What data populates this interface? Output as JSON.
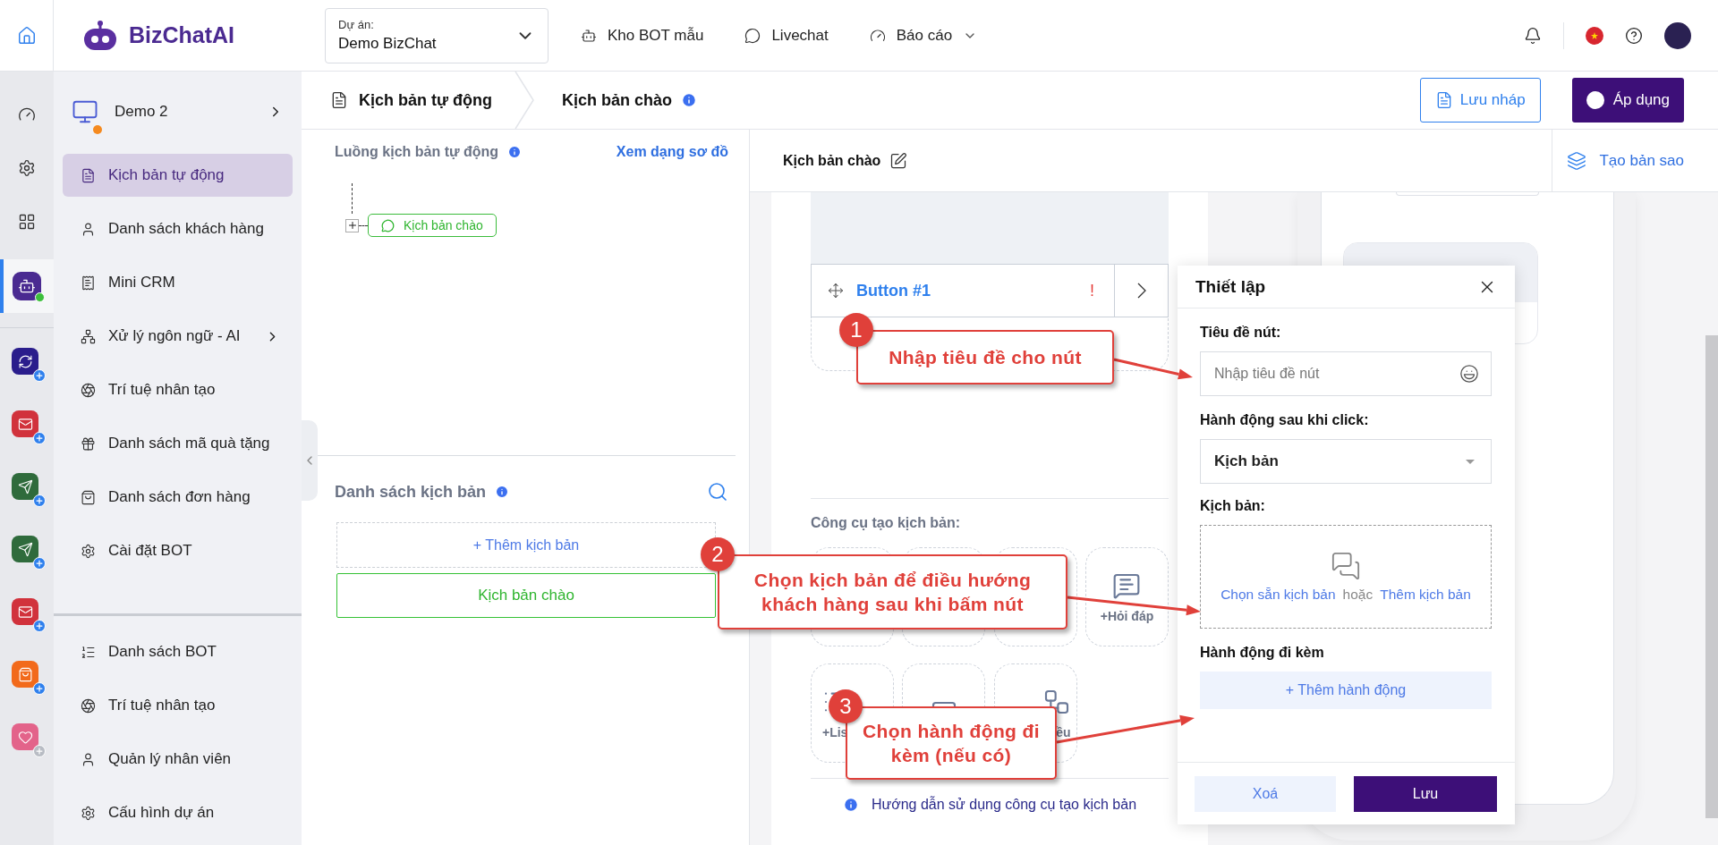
{
  "topbar": {
    "logo": "BizChatAI",
    "project": {
      "label": "Dự án:",
      "value": "Demo BizChat"
    },
    "nav": [
      {
        "kind": "bot",
        "label": "Kho BOT mẫu",
        "dropdown": false
      },
      {
        "kind": "chat",
        "label": "Livechat",
        "dropdown": false
      },
      {
        "kind": "gauge",
        "label": "Báo cáo",
        "dropdown": true
      }
    ]
  },
  "rail": {
    "items": [
      {
        "kind": "gauge",
        "selected": false
      },
      {
        "kind": "settings",
        "selected": false
      },
      {
        "kind": "grid",
        "selected": false
      },
      {
        "kind": "bot",
        "selected": true
      }
    ],
    "apps": [
      {
        "kind": "refresh",
        "color": "#2a1d8c",
        "added": true
      },
      {
        "kind": "mail",
        "color": "#d1323c",
        "added": true
      },
      {
        "kind": "send",
        "color": "#2f6b3c",
        "added": true
      },
      {
        "kind": "send",
        "color": "#2f6b3c",
        "added": true
      },
      {
        "kind": "mail",
        "color": "#d1323c",
        "added": true
      },
      {
        "kind": "bag",
        "color": "#f26a1b",
        "added": true
      },
      {
        "kind": "heart",
        "color": "#e3638a",
        "added": false
      }
    ]
  },
  "sidebar": {
    "project": "Demo 2",
    "items": [
      {
        "kind": "script",
        "label": "Kịch bản tự động",
        "selected": true,
        "submenu": false
      },
      {
        "kind": "user",
        "label": "Danh sách khách hàng",
        "selected": false,
        "submenu": false
      },
      {
        "kind": "crm",
        "label": "Mini CRM",
        "selected": false,
        "submenu": false
      },
      {
        "kind": "nlp",
        "label": "Xử lý ngôn ngữ - AI",
        "selected": false,
        "submenu": true
      },
      {
        "kind": "ai",
        "label": "Trí tuệ nhân tạo",
        "selected": false,
        "submenu": false
      },
      {
        "kind": "gift",
        "label": "Danh sách mã quà tặng",
        "selected": false,
        "submenu": false
      },
      {
        "kind": "bag",
        "label": "Danh sách đơn hàng",
        "selected": false,
        "submenu": false
      },
      {
        "kind": "settings",
        "label": "Cài đặt BOT",
        "selected": false,
        "submenu": false
      }
    ],
    "bottom_items": [
      {
        "kind": "list",
        "label": "Danh sách BOT",
        "selected": false
      },
      {
        "kind": "ai",
        "label": "Trí tuệ nhân tạo",
        "selected": false
      },
      {
        "kind": "user",
        "label": "Quản lý nhân viên",
        "selected": false
      },
      {
        "kind": "settings",
        "label": "Cấu hình dự án",
        "selected": false
      }
    ]
  },
  "breadcrumb": [
    "Kịch bản tự động",
    "Kịch bản chào"
  ],
  "actions": {
    "save_draft": "Lưu nháp",
    "apply": "Áp dụng"
  },
  "flow": {
    "title": "Luồng kịch bản tự động",
    "view_link": "Xem dạng sơ đồ",
    "node": "Kịch bản chào"
  },
  "scripts": {
    "title": "Danh sách kịch bản",
    "add": "+ Thêm kịch bản",
    "items": [
      {
        "label": "Kịch bản chào",
        "selected": true
      }
    ]
  },
  "editor": {
    "title": "Kịch bản chào",
    "copy": "Tạo bản sao",
    "button_row": {
      "label": "Button #1",
      "warning": "!"
    },
    "tools_label": "Công cụ tạo kịch bản:",
    "tools": [
      {
        "kind": "blank"
      },
      {
        "kind": "blank"
      },
      {
        "kind": "blank"
      },
      {
        "kind": "qa",
        "label": "+Hỏi đáp"
      },
      {
        "kind": "list",
        "label": "+Lis"
      },
      {
        "kind": "check"
      },
      {
        "kind": "tree",
        "label": "ều"
      }
    ],
    "guide": "Hướng dẫn sử dụng công cụ tạo kịch bản"
  },
  "dialog": {
    "title": "Thiết lập",
    "title_label": "Tiêu đề nút:",
    "title_placeholder": "Nhập tiêu đề nút",
    "action_label": "Hành động sau khi click:",
    "action_value": "Kịch bản",
    "script_label": "Kịch bản:",
    "pick_link": "Chọn sẵn kịch bản",
    "or": "hoặc",
    "add_link": "Thêm kịch bản",
    "extra_label": "Hành động đi kèm",
    "add_action": "+ Thêm hành động",
    "delete": "Xoá",
    "save": "Lưu"
  },
  "callouts": [
    {
      "number": "1",
      "text": "Nhập tiêu đề cho nút"
    },
    {
      "number": "2",
      "text": "Chọn kịch bản để điều hướng khách hàng sau khi bấm nút"
    },
    {
      "number": "3",
      "text": "Chọn hành động đi kèm (nếu có)"
    }
  ]
}
